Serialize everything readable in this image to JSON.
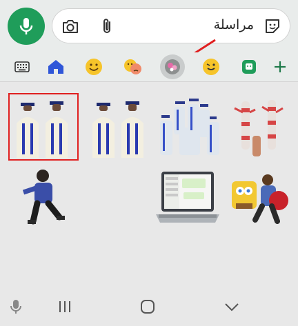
{
  "composer": {
    "placeholder": "مراسلة",
    "icons": [
      "emoji-sticker-icon",
      "attach-icon",
      "camera-icon"
    ]
  },
  "mic_button": {
    "icon": "mic-icon",
    "color": "#1f9d5a"
  },
  "sticker_tabs": [
    {
      "name": "keyboard-icon"
    },
    {
      "name": "home-icon"
    },
    {
      "name": "smile-emoji-icon"
    },
    {
      "name": "mixed-emotions-icon"
    },
    {
      "name": "sticker-pack-flowers-icon",
      "selected": true
    },
    {
      "name": "wink-emoji-icon"
    },
    {
      "name": "chat-sticker-icon"
    },
    {
      "name": "plus-icon"
    }
  ],
  "stickers": [
    {
      "name": "graduates-sticker-1",
      "highlighted": true
    },
    {
      "name": "graduates-sticker-2"
    },
    {
      "name": "graduation-group-sticker"
    },
    {
      "name": "clowns-sticker"
    },
    {
      "name": "boy-sitting-sticker"
    },
    {
      "name": "laptop-chat-sticker"
    },
    {
      "name": "boy-with-plush-sticker"
    }
  ],
  "navbar": {
    "icons": [
      "mic-icon",
      "recent-apps-icon",
      "home-icon",
      "back-icon"
    ]
  },
  "colors": {
    "accent": "#1f9d5a",
    "annotation": "#e02020"
  }
}
